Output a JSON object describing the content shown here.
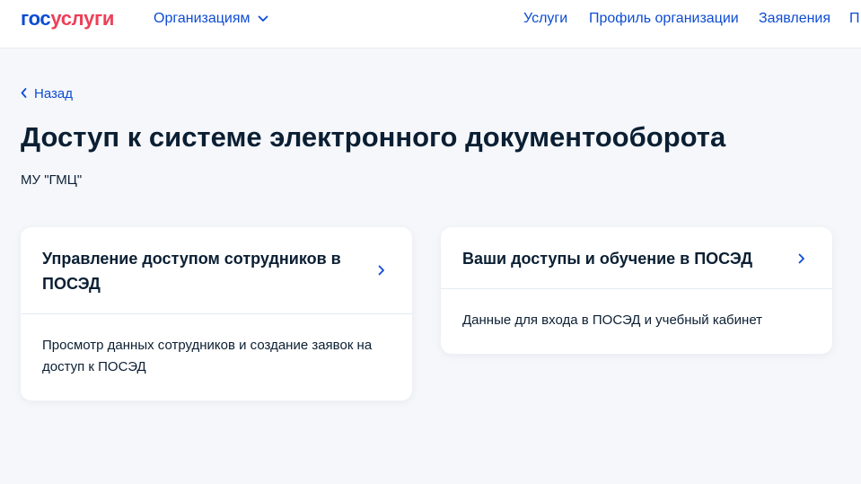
{
  "header": {
    "logo": {
      "part1": "гос",
      "part2": "услуги"
    },
    "org_menu_label": "Организациям",
    "nav": [
      "Услуги",
      "Профиль организации",
      "Заявления",
      "П"
    ]
  },
  "back_label": "Назад",
  "page_title": "Доступ к системе электронного документооборота",
  "organization": "МУ \"ГМЦ\"",
  "cards": [
    {
      "title": "Управление доступом сотрудников в ПОСЭД",
      "description": "Просмотр данных сотрудников и создание заявок на доступ к ПОСЭД"
    },
    {
      "title": "Ваши доступы и обучение в ПОСЭД",
      "description": "Данные для входа в ПОСЭД и учебный кабинет"
    }
  ],
  "colors": {
    "accent": "#0d4cd3",
    "logo_red": "#ee3f58",
    "text": "#0b1f33",
    "background": "#f5f7fb"
  }
}
